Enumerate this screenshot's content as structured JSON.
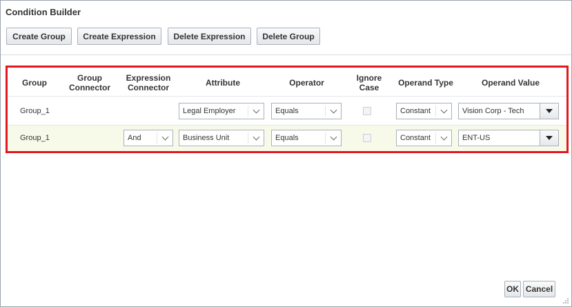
{
  "dialog": {
    "title": "Condition Builder"
  },
  "toolbar": {
    "create_group": "Create Group",
    "create_expression": "Create Expression",
    "delete_expression": "Delete Expression",
    "delete_group": "Delete Group"
  },
  "grid": {
    "headers": {
      "group": "Group",
      "group_connector_1": "Group",
      "group_connector_2": "Connector",
      "expression_connector_1": "Expression",
      "expression_connector_2": "Connector",
      "attribute": "Attribute",
      "operator": "Operator",
      "ignore_case_1": "Ignore",
      "ignore_case_2": "Case",
      "operand_type": "Operand Type",
      "operand_value": "Operand Value"
    },
    "rows": [
      {
        "group": "Group_1",
        "group_connector": "",
        "expression_connector": "",
        "attribute": "Legal Employer",
        "operator": "Equals",
        "ignore_case": false,
        "operand_type": "Constant",
        "operand_value": "Vision Corp - Tech"
      },
      {
        "group": "Group_1",
        "group_connector": "",
        "expression_connector": "And",
        "attribute": "Business Unit",
        "operator": "Equals",
        "ignore_case": false,
        "operand_type": "Constant",
        "operand_value": "ENT-US"
      }
    ]
  },
  "footer": {
    "ok": "OK",
    "cancel": "Cancel"
  },
  "colors": {
    "highlight_border": "#e3171f",
    "selected_row_bg": "#f8fae9"
  }
}
